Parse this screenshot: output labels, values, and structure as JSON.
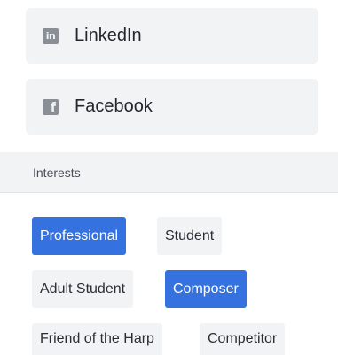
{
  "social": {
    "linkedin": {
      "label": "LinkedIn",
      "icon": "linkedin-icon",
      "glyph": "in"
    },
    "facebook": {
      "label": "Facebook",
      "icon": "facebook-icon",
      "glyph": "f"
    }
  },
  "interests": {
    "header": "Interests",
    "chips": [
      {
        "label": "Professional",
        "selected": true
      },
      {
        "label": "Student",
        "selected": false
      },
      {
        "label": "Adult Student",
        "selected": false
      },
      {
        "label": "Composer",
        "selected": true
      },
      {
        "label": "Friend of the Harp",
        "selected": false
      },
      {
        "label": "Competitor",
        "selected": false
      }
    ]
  },
  "colors": {
    "selected": "#3572e0",
    "unselected": "#f2f3f5",
    "text": "#23272c"
  }
}
